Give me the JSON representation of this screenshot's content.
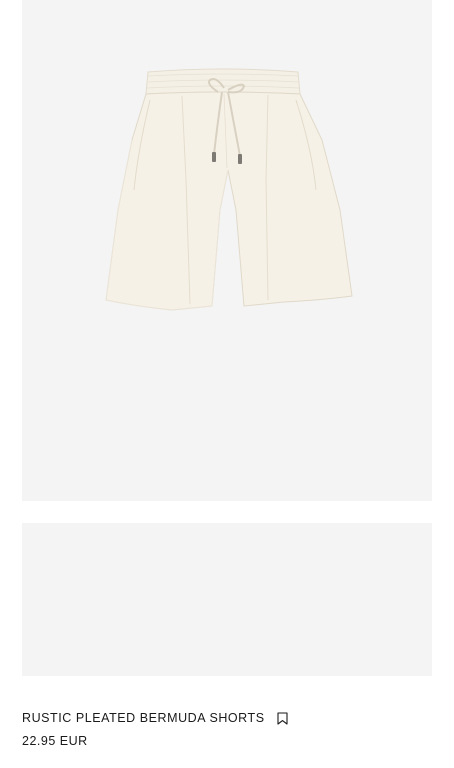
{
  "product": {
    "name": "RUSTIC PLEATED BERMUDA SHORTS",
    "price": "22.95",
    "currency": "EUR",
    "image_subject": "cream pleated bermuda shorts with drawstring waist",
    "image_background_color": "#f4f4f4",
    "garment_color": "#f4efe4"
  },
  "icons": {
    "save": "bookmark-icon"
  }
}
